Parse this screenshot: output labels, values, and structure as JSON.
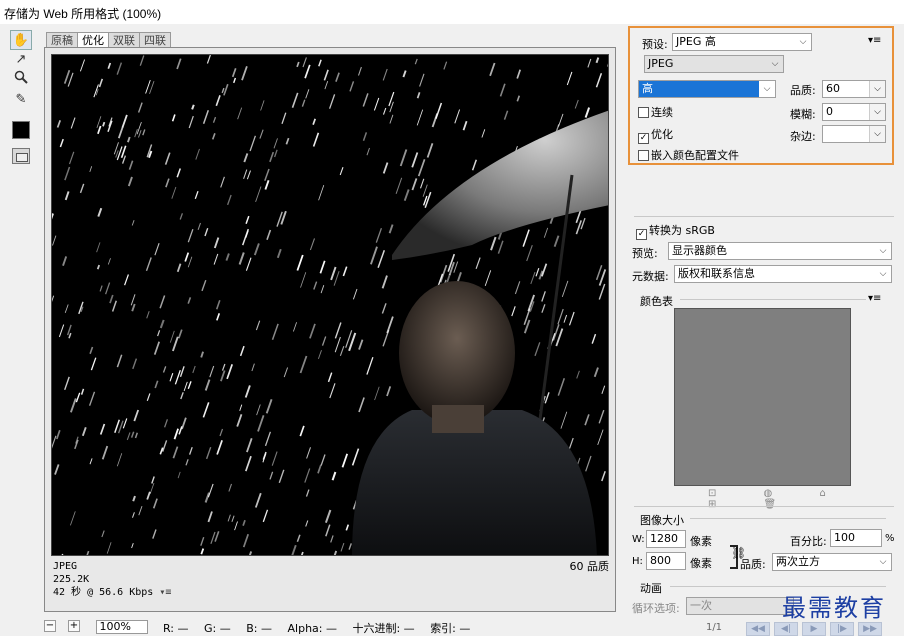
{
  "window": {
    "title": "存储为 Web 所用格式 (100%)"
  },
  "toolbar": {
    "tools": [
      {
        "name": "hand-tool",
        "glyph": "✋"
      },
      {
        "name": "slice-select-tool",
        "glyph": "↗"
      },
      {
        "name": "zoom-tool",
        "glyph": "🔍"
      },
      {
        "name": "eyedropper-tool",
        "glyph": "✎"
      }
    ],
    "eyedropper_color": "#000000"
  },
  "tabs": [
    {
      "label": "原稿",
      "active": false
    },
    {
      "label": "优化",
      "active": true
    },
    {
      "label": "双联",
      "active": false
    },
    {
      "label": "四联",
      "active": false
    }
  ],
  "document": {
    "format": "JPEG",
    "size": "225.2K",
    "speed": "42 秒 @ 56.6 Kbps",
    "quality_text": "60 品质",
    "menu_icon": "▾≡"
  },
  "statusbar": {
    "zoom": "100%",
    "r": "R: —",
    "g": "G: —",
    "b": "B: —",
    "alpha": "Alpha: —",
    "hex": "十六进制: —",
    "index": "索引: —"
  },
  "panel": {
    "preset_label": "预设:",
    "preset_value": "JPEG 高",
    "format_value": "JPEG",
    "quality_level": "高",
    "quality_label": "品质:",
    "quality_value": "60",
    "progressive_label": "连续",
    "progressive_checked": false,
    "blur_label": "模糊:",
    "blur_value": "0",
    "optimized_label": "优化",
    "optimized_checked": true,
    "matte_label": "杂边:",
    "matte_value": "",
    "embed_profile_label": "嵌入颜色配置文件",
    "embed_profile_checked": false,
    "convert_srgb_label": "转换为 sRGB",
    "convert_srgb_checked": true,
    "preview_label": "预览:",
    "preview_value": "显示器颜色",
    "metadata_label": "元数据:",
    "metadata_value": "版权和联系信息",
    "color_table_label": "颜色表",
    "color_table_icons": "⊡ ◍ ⌂ ⊞ 🗑",
    "image_size_label": "图像大小",
    "w_label": "W:",
    "w_value": "1280",
    "h_label": "H:",
    "h_value": "800",
    "unit": "像素",
    "percent_label": "百分比:",
    "percent_value": "100",
    "percent_sign": "%",
    "resample_label": "品质:",
    "resample_value": "两次立方",
    "animation_label": "动画",
    "loop_label": "循环选项:",
    "loop_value": "一次",
    "frame_indicator": "1/1",
    "panel_menu_icon": "▾≡"
  },
  "watermark": "最需教育",
  "colors": {
    "highlight": "#e8913a",
    "selection": "#1a74d6",
    "watermark": "#1d3fa3"
  }
}
